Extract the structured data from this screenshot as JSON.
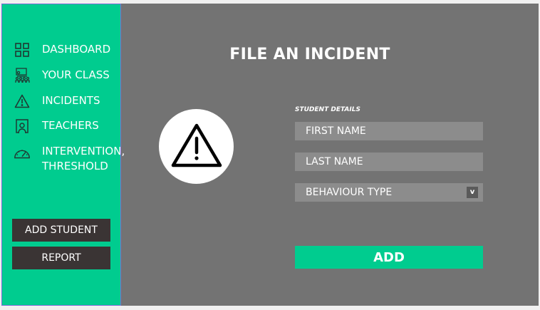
{
  "sidebar": {
    "items": [
      {
        "label": "DASHBOARD",
        "icon": "dashboard-grid-icon"
      },
      {
        "label": "YOUR CLASS",
        "icon": "classroom-icon"
      },
      {
        "label": "INCIDENTS",
        "icon": "warning-icon"
      },
      {
        "label": "TEACHERS",
        "icon": "teacher-icon"
      },
      {
        "label": "INTERVENTION,\nTHRESHOLD",
        "icon": "gauge-icon"
      }
    ],
    "add_student_label": "ADD STUDENT",
    "report_label": "REPORT"
  },
  "main": {
    "title": "FILE AN INCIDENT",
    "alert_icon": "warning-icon",
    "section_label": "STUDENT DETAILS",
    "first_name_placeholder": "FIRST NAME",
    "last_name_placeholder": "LAST NAME",
    "behaviour_type_value": "BEHAVIOUR TYPE",
    "dropdown_chevron": "v",
    "add_label": "ADD"
  },
  "colors": {
    "accent": "#00cc8f",
    "panel": "#737373",
    "field": "#8c8c8c",
    "dark_button": "#3a3434"
  }
}
